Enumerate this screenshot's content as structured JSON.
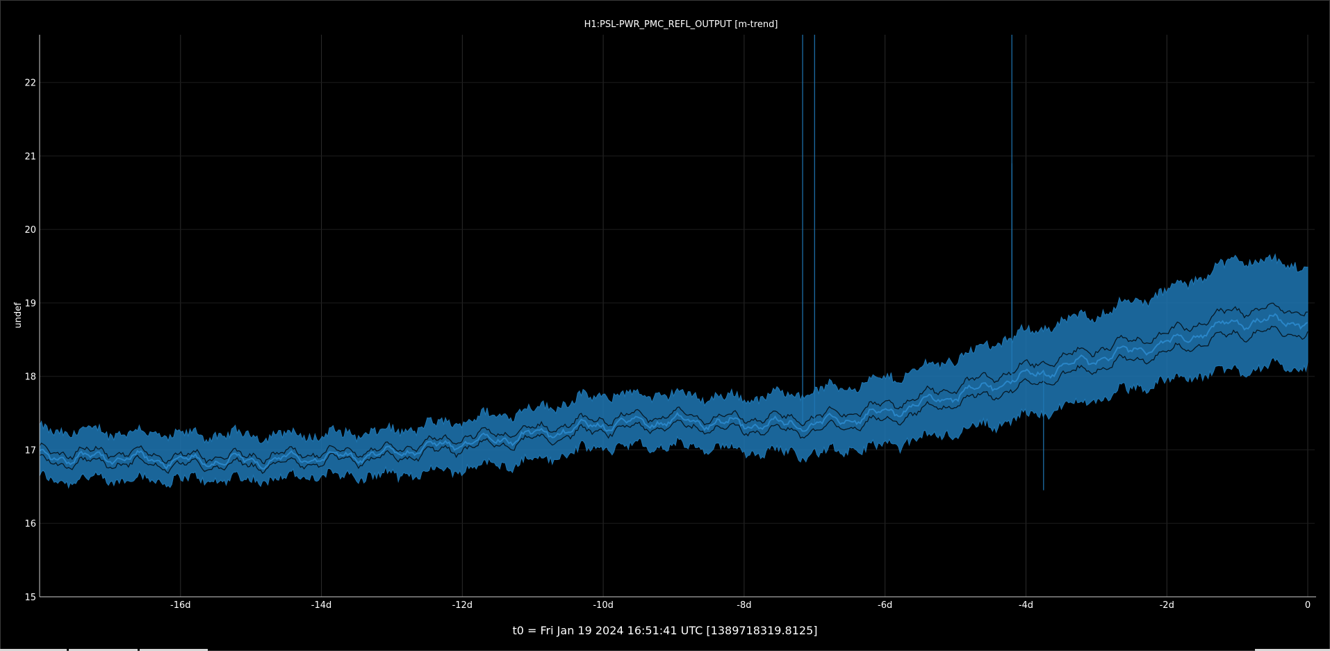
{
  "chart_data": {
    "type": "line",
    "title": "H1:PSL-PWR_PMC_REFL_OUTPUT [m-trend]",
    "xlabel": "",
    "ylabel": "undef",
    "x_unit": "days",
    "xlim": [
      -18,
      0
    ],
    "ylim": [
      15,
      22.65
    ],
    "x_ticks": [
      -16,
      -14,
      -12,
      -10,
      -8,
      -6,
      -4,
      -2,
      0
    ],
    "x_tick_labels": [
      "-16d",
      "-14d",
      "-12d",
      "-10d",
      "-8d",
      "-6d",
      "-4d",
      "-2d",
      "0"
    ],
    "y_ticks": [
      15,
      16,
      17,
      18,
      19,
      20,
      21,
      22
    ],
    "y_tick_labels": [
      "15",
      "16",
      "17",
      "18",
      "19",
      "20",
      "21",
      "22"
    ],
    "grid": true,
    "legend": "none",
    "series_color": "#1f77b4",
    "series": [
      {
        "x": [
          -18,
          -17,
          -16,
          -15,
          -14,
          -13,
          -12,
          -11,
          -10,
          -9,
          -8,
          -7,
          -6,
          -5,
          -4,
          -3,
          -2,
          -1,
          0
        ],
        "mean": [
          16.9,
          16.9,
          16.85,
          16.85,
          16.9,
          16.95,
          17.1,
          17.2,
          17.35,
          17.4,
          17.35,
          17.35,
          17.5,
          17.75,
          18.0,
          18.25,
          18.45,
          18.75,
          18.75
        ],
        "min": [
          16.6,
          16.6,
          16.6,
          16.6,
          16.65,
          16.65,
          16.75,
          16.85,
          17.05,
          17.05,
          17.0,
          16.95,
          17.05,
          17.25,
          17.45,
          17.7,
          17.95,
          18.1,
          18.15
        ],
        "max": [
          17.25,
          17.25,
          17.2,
          17.2,
          17.2,
          17.25,
          17.4,
          17.55,
          17.75,
          17.75,
          17.7,
          17.8,
          17.95,
          18.25,
          18.6,
          18.85,
          19.15,
          19.6,
          19.5
        ]
      }
    ],
    "spikes": [
      {
        "x": -7.17,
        "y": 22.65
      },
      {
        "x": -7.0,
        "y": 22.65
      },
      {
        "x": -4.2,
        "y": 22.65
      },
      {
        "x": -4.2,
        "y": 20.9
      },
      {
        "x": -3.75,
        "y": 16.45
      }
    ]
  },
  "footer": {
    "t0": "t0 = Fri Jan 19 2024 16:51:41 UTC [1389718319.8125]"
  }
}
